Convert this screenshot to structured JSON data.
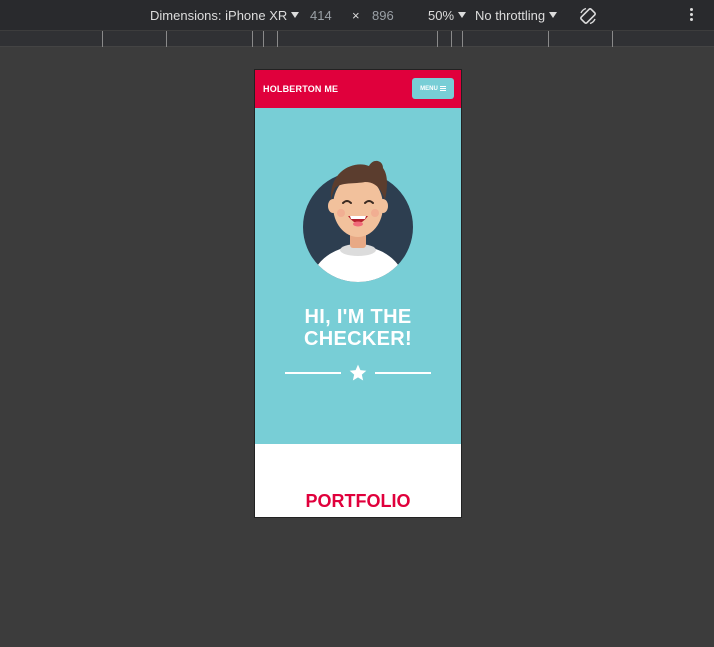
{
  "devtools": {
    "dimensions_label": "Dimensions: iPhone XR",
    "width": "414",
    "times": "×",
    "height": "896",
    "zoom": "50%",
    "throttling": "No throttling"
  },
  "site": {
    "brand": "HOLBERTON ME",
    "menu_label": "MENU",
    "hero_title": "HI, I'M THE CHECKER!",
    "section_title": "PORTFOLIO"
  },
  "colors": {
    "primary": "#e0003c",
    "hero_bg": "#78ced6",
    "avatar_bg": "#2d3e50"
  }
}
